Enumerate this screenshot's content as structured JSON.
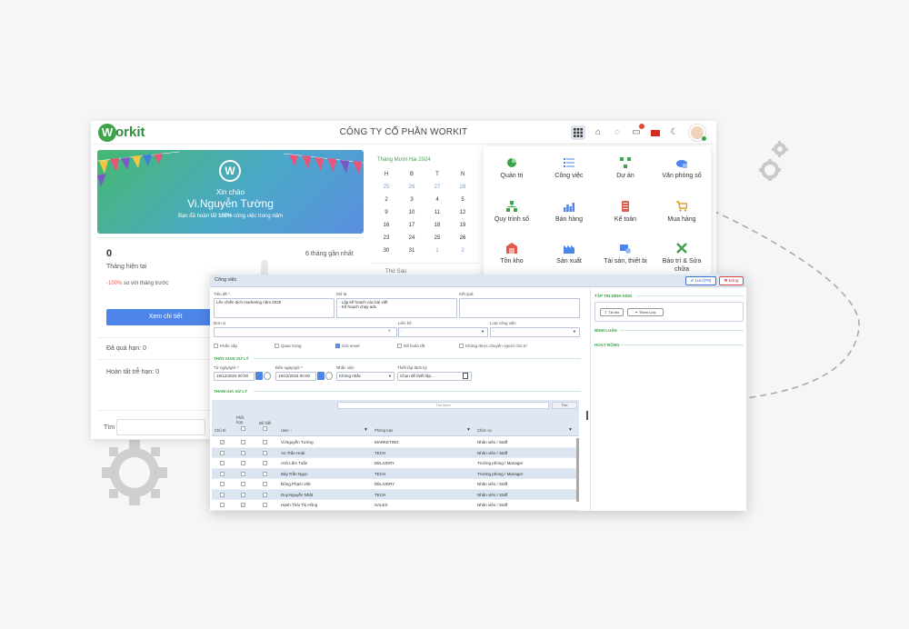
{
  "header": {
    "company": "CÔNG TY CỔ PHẦN WORKIT",
    "logo_text": "orkit"
  },
  "banner": {
    "greeting": "Xin chào",
    "name": "Vi.Nguyễn Tường",
    "subtitle_pre": "Bạn đã hoàn tất ",
    "subtitle_bold": "100%",
    "subtitle_post": " công việc trong năm"
  },
  "stats": {
    "value": "0",
    "month_label": "Tháng hiện tại",
    "six_months": "6 tháng gần nhất",
    "change_pct": "-100%",
    "change_text": " so với tháng trước",
    "detail_button": "Xem chi tiết",
    "overdue": "Đã quá hạn: 0",
    "late_done": "Hoàn tất trễ hạn: 0",
    "search_label": "Tìm"
  },
  "calendar": {
    "title": "Tháng Mười Hai 2024",
    "headers": [
      "H",
      "B",
      "T",
      "N"
    ],
    "rows": [
      [
        "25",
        "26",
        "27",
        "28"
      ],
      [
        "2",
        "3",
        "4",
        "5"
      ],
      [
        "9",
        "10",
        "11",
        "12"
      ],
      [
        "16",
        "17",
        "18",
        "19"
      ],
      [
        "23",
        "24",
        "25",
        "26"
      ],
      [
        "30",
        "31",
        "1",
        "2"
      ]
    ],
    "friday": "Thứ Sáu"
  },
  "app_menu": {
    "items": [
      {
        "label": "Quản trị",
        "icon": "admin-icon"
      },
      {
        "label": "Công việc",
        "icon": "tasks-icon"
      },
      {
        "label": "Dự án",
        "icon": "project-icon"
      },
      {
        "label": "Văn phòng số",
        "icon": "office-icon"
      },
      {
        "label": "Quy trình số",
        "icon": "workflow-icon"
      },
      {
        "label": "Bán hàng",
        "icon": "sales-icon"
      },
      {
        "label": "Kế toán",
        "icon": "accounting-icon"
      },
      {
        "label": "Mua hàng",
        "icon": "purchase-icon"
      },
      {
        "label": "Tồn kho",
        "icon": "inventory-icon"
      },
      {
        "label": "Sản xuất",
        "icon": "production-icon"
      },
      {
        "label": "Tài sản, thiết bị",
        "icon": "assets-icon"
      },
      {
        "label": "Bảo trì & Sửa chữa",
        "icon": "maintenance-icon"
      }
    ],
    "colors": [
      "#3ea34a",
      "#4d86e8",
      "#3ea34a",
      "#4d86e8",
      "#3ea34a",
      "#4d86e8",
      "#e05b4a",
      "#e0a030",
      "#e05b4a",
      "#4d86e8",
      "#4d86e8",
      "#3ea34a"
    ]
  },
  "dialog": {
    "title": "Công việc",
    "save": "✔ Lưu (F8)",
    "close": "✖ Đóng",
    "fields": {
      "title_label": "Tiêu đề *",
      "title_value": "Lên chiến dịch marketing năm 2025",
      "desc_label": "Mô tả",
      "desc_value_1": "- Lập kế hoạch các bài viết",
      "desc_value_2": "- Kế hoạch chạy ads",
      "result_label": "Kết quả",
      "unit_label": "Đơn vị",
      "contact_label": "Liên hệ",
      "contact_value": "-",
      "type_label": "Loại công việc",
      "type_value": "-"
    },
    "checks": [
      "Khẩn cấp",
      "Quan trọng",
      "Gửi email",
      "Đã hoàn tất",
      "Không được chuyển người chủ trì"
    ],
    "section_time": "THỜI GIAN XỬ LÝ",
    "from_label": "Từ ngày/giờ *",
    "from_value": "19/12/2024 00:00",
    "to_label": "Đến ngày/giờ *",
    "to_value": "19/12/2024 00:00",
    "remind_label": "Nhắc việc",
    "remind_value": "Không nhắc",
    "schedule_label": "Thiết lập định kỳ",
    "schedule_value": "Chọn để thiết lập...",
    "section_people": "THAM GIA XỬ LÝ",
    "search_placeholder": "Tìm kiếm",
    "find_button": "Tìm",
    "columns": {
      "owner": "Chủ trì",
      "coord": "Phối hợp",
      "know": "Để biết",
      "user": "User ↑",
      "dept": "Phòng ban",
      "role": "Chức vụ"
    },
    "rows": [
      {
        "user": "Vi.Nguyễn Tường",
        "dept": "MARKETING",
        "role": "Nhân viên / Staff",
        "owner": "✓",
        "coord": ""
      },
      {
        "user": "An.Trần Hoài",
        "dept": "TECH",
        "role": "Nhân viên / Staff",
        "owner": "",
        "coord": ""
      },
      {
        "user": "Anh.Lâm Tuấn",
        "dept": "DELIVERY",
        "role": "Trưởng phòng / Manager",
        "owner": "",
        "coord": ""
      },
      {
        "user": "Bảy.Trần Ngọc",
        "dept": "TECH",
        "role": "Trưởng phòng / Manager",
        "owner": "",
        "coord": ""
      },
      {
        "user": "Đông.Phạm Việt",
        "dept": "DELIVERY",
        "role": "Nhân viên / Staff",
        "owner": "",
        "coord": ""
      },
      {
        "user": "Duy.Nguyễn Nhật",
        "dept": "TECH",
        "role": "Nhân viên / Staff",
        "owner": "",
        "coord": ""
      },
      {
        "user": "Hạnh.Thái Thị Hồng",
        "dept": "SALES",
        "role": "Nhân viên / Staff",
        "owner": "",
        "coord": "✓"
      }
    ],
    "right": {
      "attach": "TẬP TIN ĐÍNH KÈM",
      "upload": "⇪ Tải lên",
      "add_link": "⚭ Thêm Link",
      "comments": "BÌNH LUẬN",
      "activity": "HOẠT ĐỘNG"
    }
  }
}
